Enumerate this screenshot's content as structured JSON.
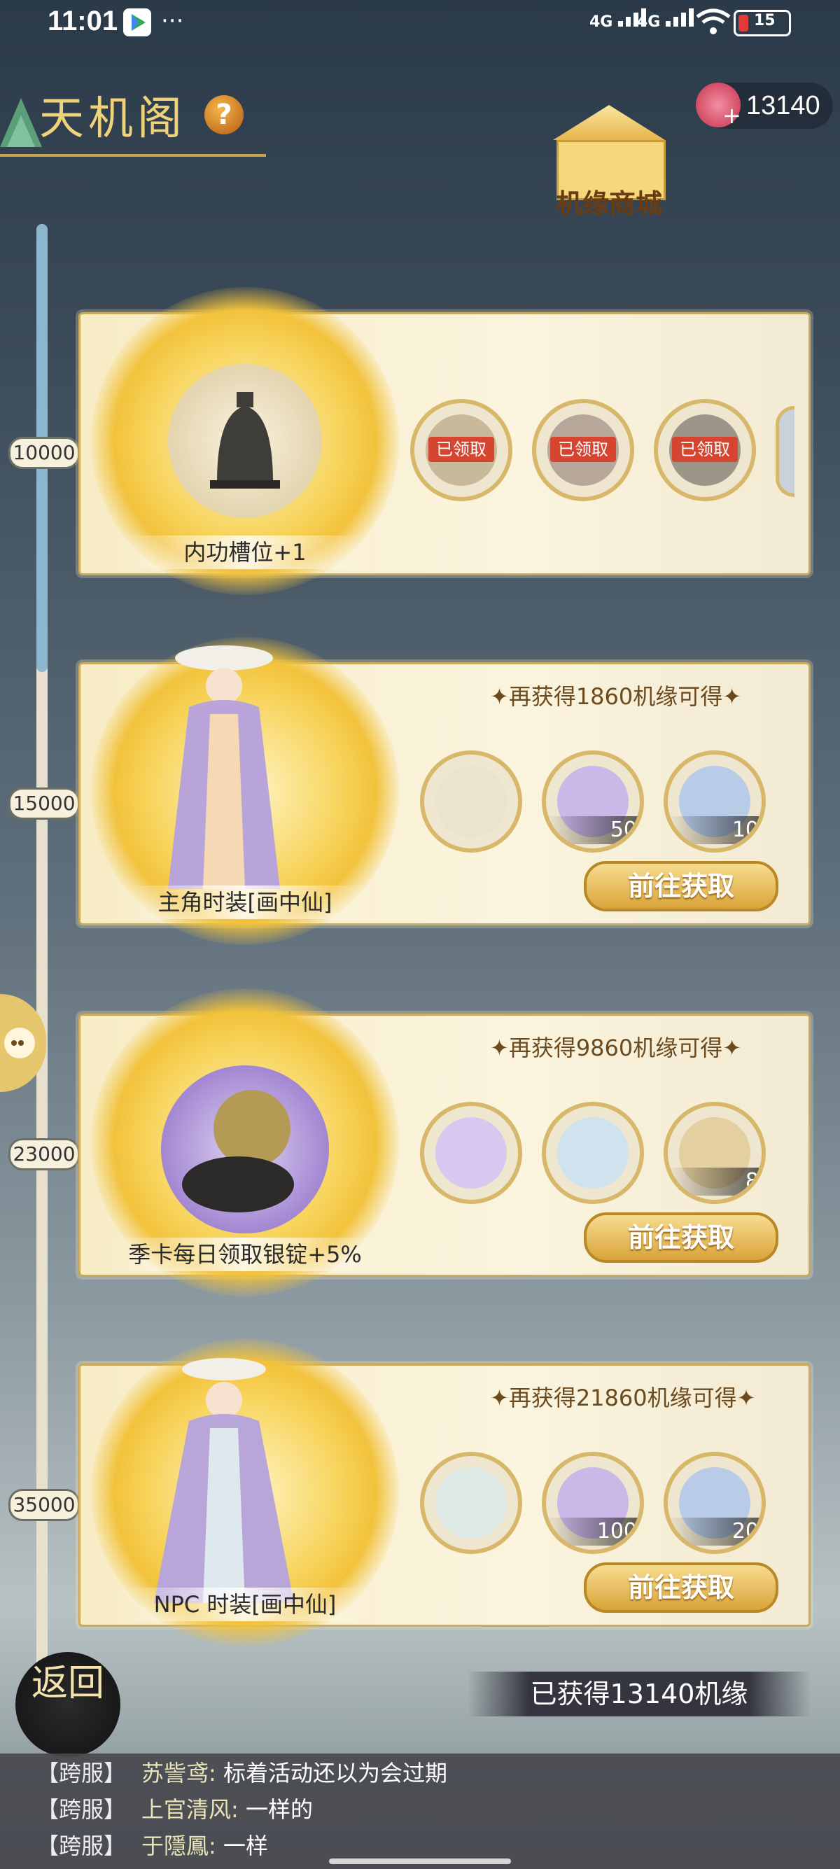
{
  "status_bar": {
    "time": "11:01",
    "dots": "···",
    "signal1": "4G",
    "signal2": "4G",
    "battery": "15"
  },
  "header": {
    "title": "天机阁",
    "help": "?",
    "currency_value": "13140",
    "shop_label": "机缘商城"
  },
  "progress_marks": [
    "10000",
    "15000",
    "23000",
    "35000"
  ],
  "cards": [
    {
      "prize": "内功槽位+1",
      "rewards": [
        {
          "badge": "已领取",
          "icon": "lotus-icon"
        },
        {
          "badge": "已领取",
          "icon": "crane-icon"
        },
        {
          "badge": "已领取",
          "icon": "bell-icon"
        }
      ]
    },
    {
      "prize": "主角时装[画中仙]",
      "need_text": "再获得1860机缘可得",
      "rewards": [
        {
          "qty": "",
          "icon": "chest-icon"
        },
        {
          "qty": "50",
          "icon": "sword-icon"
        },
        {
          "qty": "10",
          "icon": "orb-box-icon"
        }
      ],
      "button": "前往获取"
    },
    {
      "prize": "季卡每日领取银锭+5%",
      "need_text": "再获得9860机缘可得",
      "rewards": [
        {
          "qty": "",
          "icon": "mirror-icon"
        },
        {
          "qty": "",
          "icon": "bottle-icon"
        },
        {
          "qty": "8",
          "icon": "scroll-icon"
        }
      ],
      "button": "前往获取"
    },
    {
      "prize": "NPC 时装[画中仙]",
      "need_text": "再获得21860机缘可得",
      "rewards": [
        {
          "qty": "",
          "icon": "chest-icon"
        },
        {
          "qty": "100",
          "icon": "sword-icon"
        },
        {
          "qty": "20",
          "icon": "orb-box-icon"
        }
      ],
      "button": "前往获取"
    }
  ],
  "total_obtained": "已获得13140机缘",
  "back_button": "返回",
  "chat": [
    {
      "channel": "【跨服】",
      "name": "苏訾鸢:",
      "message": "标着活动还以为会过期"
    },
    {
      "channel": "【跨服】",
      "name": "上官清风:",
      "message": "一样的"
    },
    {
      "channel": "【跨服】",
      "name": "于隱鳳:",
      "message": "一样"
    }
  ]
}
